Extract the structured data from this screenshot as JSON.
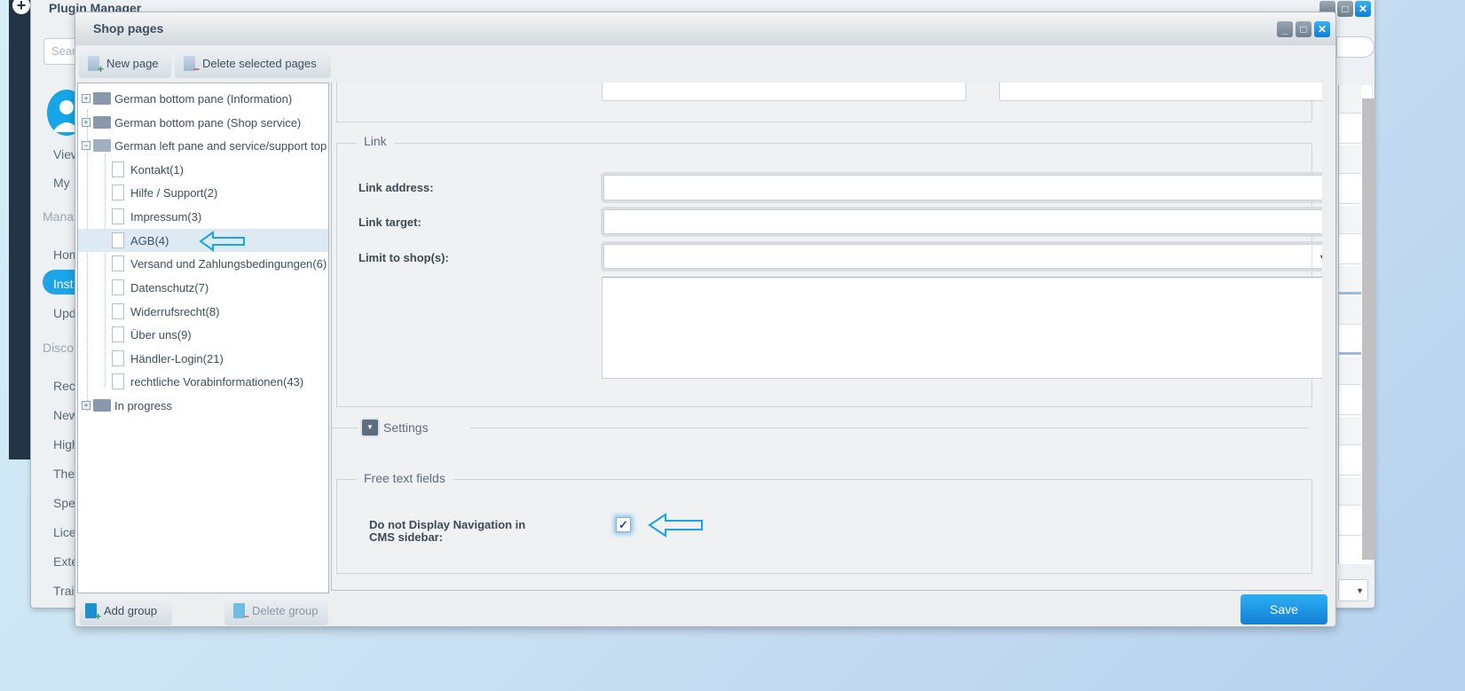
{
  "background_window": {
    "title": "Plugin Manager",
    "search_placeholder": "Search",
    "sidebar": {
      "items_top": [
        "View",
        "My"
      ],
      "section_manage": "Mana",
      "items_manage": [
        "Hom",
        "Inst",
        "Upd"
      ],
      "section_discover": "Disco",
      "items_discover": [
        "Rec",
        "New",
        "High",
        "The",
        "Spe",
        "Lice",
        "Exte",
        "Trai"
      ]
    }
  },
  "window": {
    "title": "Shop pages",
    "toolbar": {
      "new_page": "New page",
      "delete_selected": "Delete selected pages"
    },
    "tree": {
      "groups": [
        {
          "label": "German bottom pane (Information)",
          "expanded": false
        },
        {
          "label": "German bottom pane (Shop service)",
          "expanded": false
        },
        {
          "label": "German left pane and service/support top",
          "expanded": true
        }
      ],
      "pages": [
        "Kontakt(1)",
        "Hilfe / Support(2)",
        "Impressum(3)",
        "AGB(4)",
        "Versand und Zahlungsbedingungen(6)",
        "Datenschutz(7)",
        "Widerrufsrecht(8)",
        "Über uns(9)",
        "Händler-Login(21)",
        "rechtliche Vorabinformationen(43)"
      ],
      "selected_page": "AGB(4)",
      "last_group": "In progress"
    },
    "tree_footer": {
      "add_group": "Add group",
      "delete_group": "Delete group"
    },
    "form": {
      "link_legend": "Link",
      "link_address_label": "Link address:",
      "link_address_value": "",
      "link_target_label": "Link target:",
      "link_target_value": "",
      "limit_shops_label": "Limit to shop(s):",
      "limit_shops_value": "",
      "settings_legend": "Settings",
      "free_text_legend": "Free text fields",
      "no_nav_label": "Do not Display Navigation in CMS sidebar:",
      "no_nav_checked": true
    },
    "save": "Save"
  },
  "colors": {
    "accent": "#1ea4e9",
    "annotation_arrow": "#1aa3e8",
    "selected_row": "#dde9f3",
    "backend_dark": "#233446"
  }
}
